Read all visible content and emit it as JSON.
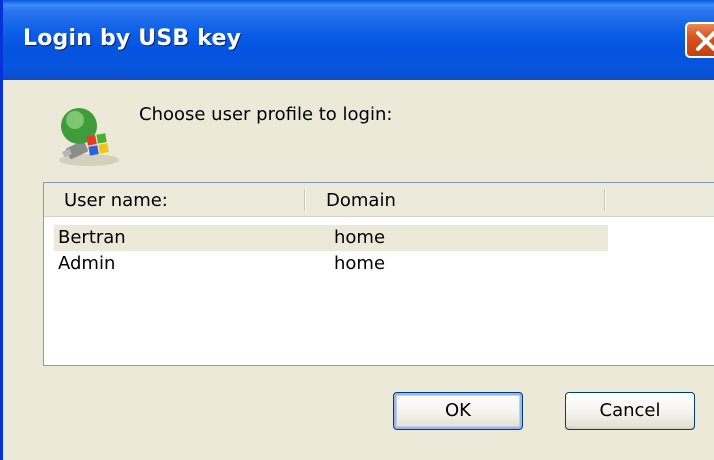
{
  "window": {
    "title": "Login by USB key",
    "close_icon": "close-icon"
  },
  "dialog": {
    "icon": "usb-key-icon",
    "prompt": "Choose user profile to login:"
  },
  "list": {
    "columns": [
      "User name:",
      "Domain"
    ],
    "rows": [
      {
        "user": "Bertran",
        "domain": "home",
        "selected": true
      },
      {
        "user": "Admin",
        "domain": "home",
        "selected": false
      }
    ]
  },
  "buttons": {
    "ok_label": "OK",
    "cancel_label": "Cancel"
  },
  "colors": {
    "title_bar": "#0454e0",
    "panel": "#ece9d8",
    "close_button": "#d9551e"
  }
}
